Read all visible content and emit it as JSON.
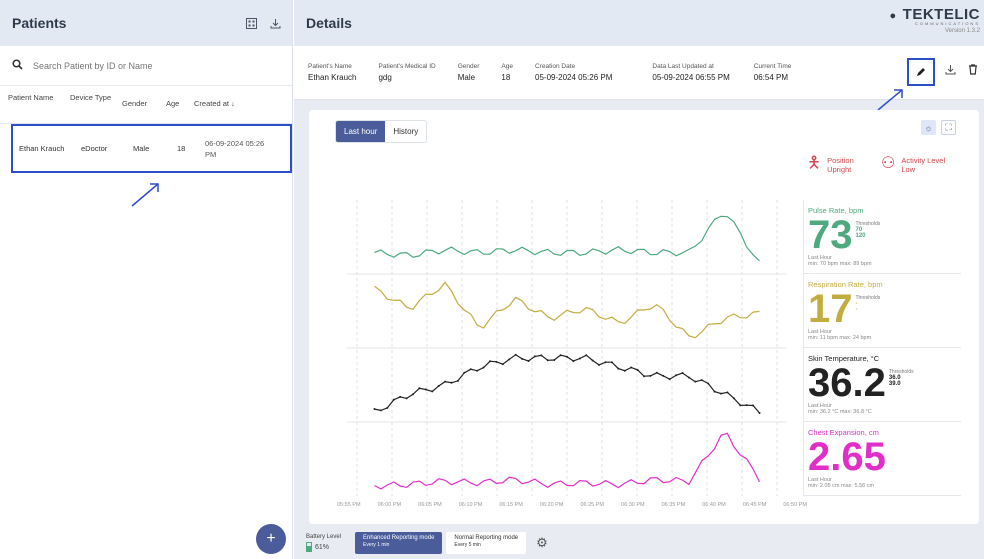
{
  "left": {
    "title": "Patients",
    "search_placeholder": "Search Patient by ID or Name",
    "columns": [
      "Patient Name",
      "Device Type",
      "Gender",
      "Age",
      "Created at"
    ],
    "rows": [
      {
        "name": "Ethan Krauch",
        "device": "eDoctor",
        "gender": "Male",
        "age": "18",
        "created": "06-09-2024 05:26 PM"
      }
    ],
    "add_label": "+"
  },
  "right": {
    "title": "Details",
    "brand": "TEKTELIC",
    "brand_sub": "COMMUNICATIONS",
    "version": "Version 1.3.2",
    "info": [
      {
        "label": "Patient's Name",
        "value": "Ethan Krauch"
      },
      {
        "label": "Patient's Medical ID",
        "value": "gdg"
      },
      {
        "label": "Gender",
        "value": "Male"
      },
      {
        "label": "Age",
        "value": "18"
      },
      {
        "label": "Creation Date",
        "value": "05-09-2024 05:26 PM"
      },
      {
        "label": "Data Last Updated at",
        "value": "05-09-2024 06:55 PM"
      },
      {
        "label": "Current Time",
        "value": "06:54 PM"
      }
    ],
    "tabs": [
      "Last hour",
      "History"
    ],
    "position": {
      "label": "Position",
      "value": "Upright"
    },
    "activity": {
      "label": "Activity Level",
      "value": "Low"
    },
    "metrics": [
      {
        "name": "Pulse Rate, bpm",
        "value": "73",
        "thr_label": "Thresholds",
        "thr1": "70",
        "thr2": "120",
        "lh": "Last Hour",
        "range": "min: 70 bpm  max: 89 bpm",
        "color": "#4daa7f"
      },
      {
        "name": "Respiration Rate, bpm",
        "value": "17",
        "thr_label": "Thresholds",
        "thr1": "-",
        "thr2": "-",
        "lh": "Last Hour",
        "range": "min: 11 bpm  max: 24 bpm",
        "color": "#c2ad3f"
      },
      {
        "name": "Skin Temperature, °C",
        "value": "36.2",
        "thr_label": "Thresholds",
        "thr1": "36.0",
        "thr2": "39.0",
        "lh": "Last Hour",
        "range": "min: 36.2 °C  max: 36.8 °C",
        "color": "#222222"
      },
      {
        "name": "Chest Expansion, cm",
        "value": "2.65",
        "thr_label": "",
        "thr1": "",
        "thr2": "",
        "lh": "Last Hour",
        "range": "min: 2.05 cm  max: 5.56 cm",
        "color": "#e22ec9"
      }
    ],
    "x_ticks": [
      "05:55 PM",
      "06:00 PM",
      "06:05 PM",
      "06:10 PM",
      "06:15 PM",
      "06:20 PM",
      "06:25 PM",
      "06:30 PM",
      "06:35 PM",
      "06:40 PM",
      "06:45 PM",
      "06:50 PM"
    ],
    "footer": {
      "battery_label": "Battery Level",
      "battery_value": "61%",
      "mode1": "Enhanced Reporting mode",
      "mode1_sub": "Every 1 min",
      "mode2": "Normal Reporting mode",
      "mode2_sub": "Every 5 min"
    }
  },
  "chart_data": {
    "type": "line",
    "x": [
      "05:55 PM",
      "06:00 PM",
      "06:05 PM",
      "06:10 PM",
      "06:15 PM",
      "06:20 PM",
      "06:25 PM",
      "06:30 PM",
      "06:35 PM",
      "06:40 PM",
      "06:45 PM",
      "06:50 PM"
    ],
    "series": [
      {
        "name": "Pulse Rate, bpm",
        "values": [
          74,
          73,
          75,
          74,
          75,
          74,
          74,
          75,
          74,
          74,
          89,
          70
        ]
      },
      {
        "name": "Respiration Rate, bpm",
        "values": [
          22,
          18,
          23,
          14,
          20,
          16,
          18,
          15,
          19,
          12,
          16,
          17
        ]
      },
      {
        "name": "Skin Temperature, °C",
        "values": [
          36.2,
          36.4,
          36.5,
          36.7,
          36.8,
          36.8,
          36.8,
          36.7,
          36.6,
          36.6,
          36.4,
          36.2
        ]
      },
      {
        "name": "Chest Expansion, cm",
        "values": [
          2.2,
          2.3,
          2.5,
          2.4,
          2.6,
          2.3,
          2.4,
          2.3,
          2.6,
          2.5,
          5.56,
          2.65
        ]
      }
    ]
  }
}
